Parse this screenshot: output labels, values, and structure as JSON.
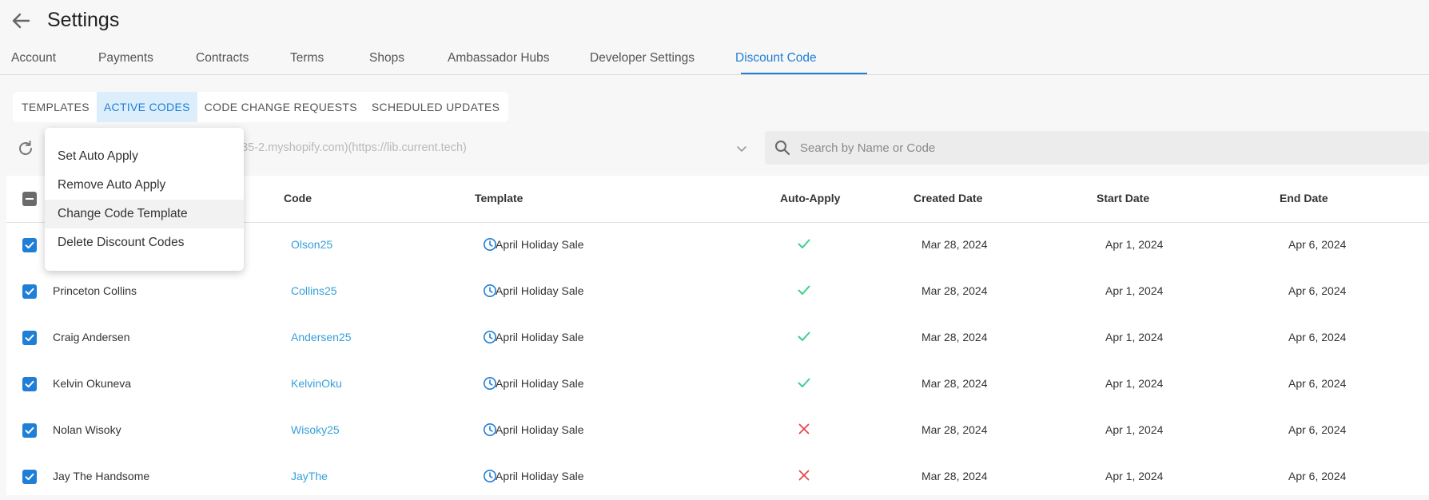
{
  "header": {
    "title": "Settings"
  },
  "main_tabs": [
    {
      "label": "Account"
    },
    {
      "label": "Payments"
    },
    {
      "label": "Contracts"
    },
    {
      "label": "Terms"
    },
    {
      "label": "Shops"
    },
    {
      "label": "Ambassador Hubs"
    },
    {
      "label": "Developer Settings"
    },
    {
      "label": "Discount Code"
    }
  ],
  "active_main_tab": "Discount Code",
  "sub_tabs": [
    {
      "label": "TEMPLATES"
    },
    {
      "label": "ACTIVE CODES"
    },
    {
      "label": "CODE CHANGE REQUESTS"
    },
    {
      "label": "SCHEDULED UPDATES"
    }
  ],
  "active_sub_tab": "ACTIVE CODES",
  "filters": {
    "shop_select_text": "f735-2.myshopify.com)(https://lib.current.tech)",
    "search_placeholder": "Search by Name or Code"
  },
  "table": {
    "columns": [
      "Code",
      "Template",
      "Auto-Apply",
      "Created Date",
      "Start Date",
      "End Date"
    ],
    "rows": [
      {
        "name": "",
        "code": "Olson25",
        "template": "April Holiday Sale",
        "auto_apply": true,
        "created": "Mar 28, 2024",
        "start": "Apr 1, 2024",
        "end": "Apr 6, 2024"
      },
      {
        "name": "Princeton Collins",
        "code": "Collins25",
        "template": "April Holiday Sale",
        "auto_apply": true,
        "created": "Mar 28, 2024",
        "start": "Apr 1, 2024",
        "end": "Apr 6, 2024"
      },
      {
        "name": "Craig Andersen",
        "code": "Andersen25",
        "template": "April Holiday Sale",
        "auto_apply": true,
        "created": "Mar 28, 2024",
        "start": "Apr 1, 2024",
        "end": "Apr 6, 2024"
      },
      {
        "name": "Kelvin Okuneva",
        "code": "KelvinOku",
        "template": "April Holiday Sale",
        "auto_apply": true,
        "created": "Mar 28, 2024",
        "start": "Apr 1, 2024",
        "end": "Apr 6, 2024"
      },
      {
        "name": "Nolan Wisoky",
        "code": "Wisoky25",
        "template": "April Holiday Sale",
        "auto_apply": false,
        "created": "Mar 28, 2024",
        "start": "Apr 1, 2024",
        "end": "Apr 6, 2024"
      },
      {
        "name": "Jay The Handsome",
        "code": "JayThe",
        "template": "April Holiday Sale",
        "auto_apply": false,
        "created": "Mar 28, 2024",
        "start": "Apr 1, 2024",
        "end": "Apr 6, 2024"
      }
    ]
  },
  "bulk_menu": {
    "items": [
      {
        "label": "Set Auto Apply"
      },
      {
        "label": "Remove Auto Apply"
      },
      {
        "label": "Change Code Template"
      },
      {
        "label": "Delete Discount Codes"
      }
    ],
    "hovered": "Change Code Template"
  },
  "colors": {
    "accent": "#1f7ed6",
    "link": "#35a0d9",
    "check_green": "#3ccf8e",
    "cross_red": "#e5484d"
  },
  "icons": {
    "back": "arrow-left-icon",
    "refresh": "refresh-icon",
    "search": "search-icon",
    "select": "chevron-down-icon",
    "template": "clock-icon",
    "auto_apply_on": "check-icon",
    "auto_apply_off": "x-icon"
  }
}
